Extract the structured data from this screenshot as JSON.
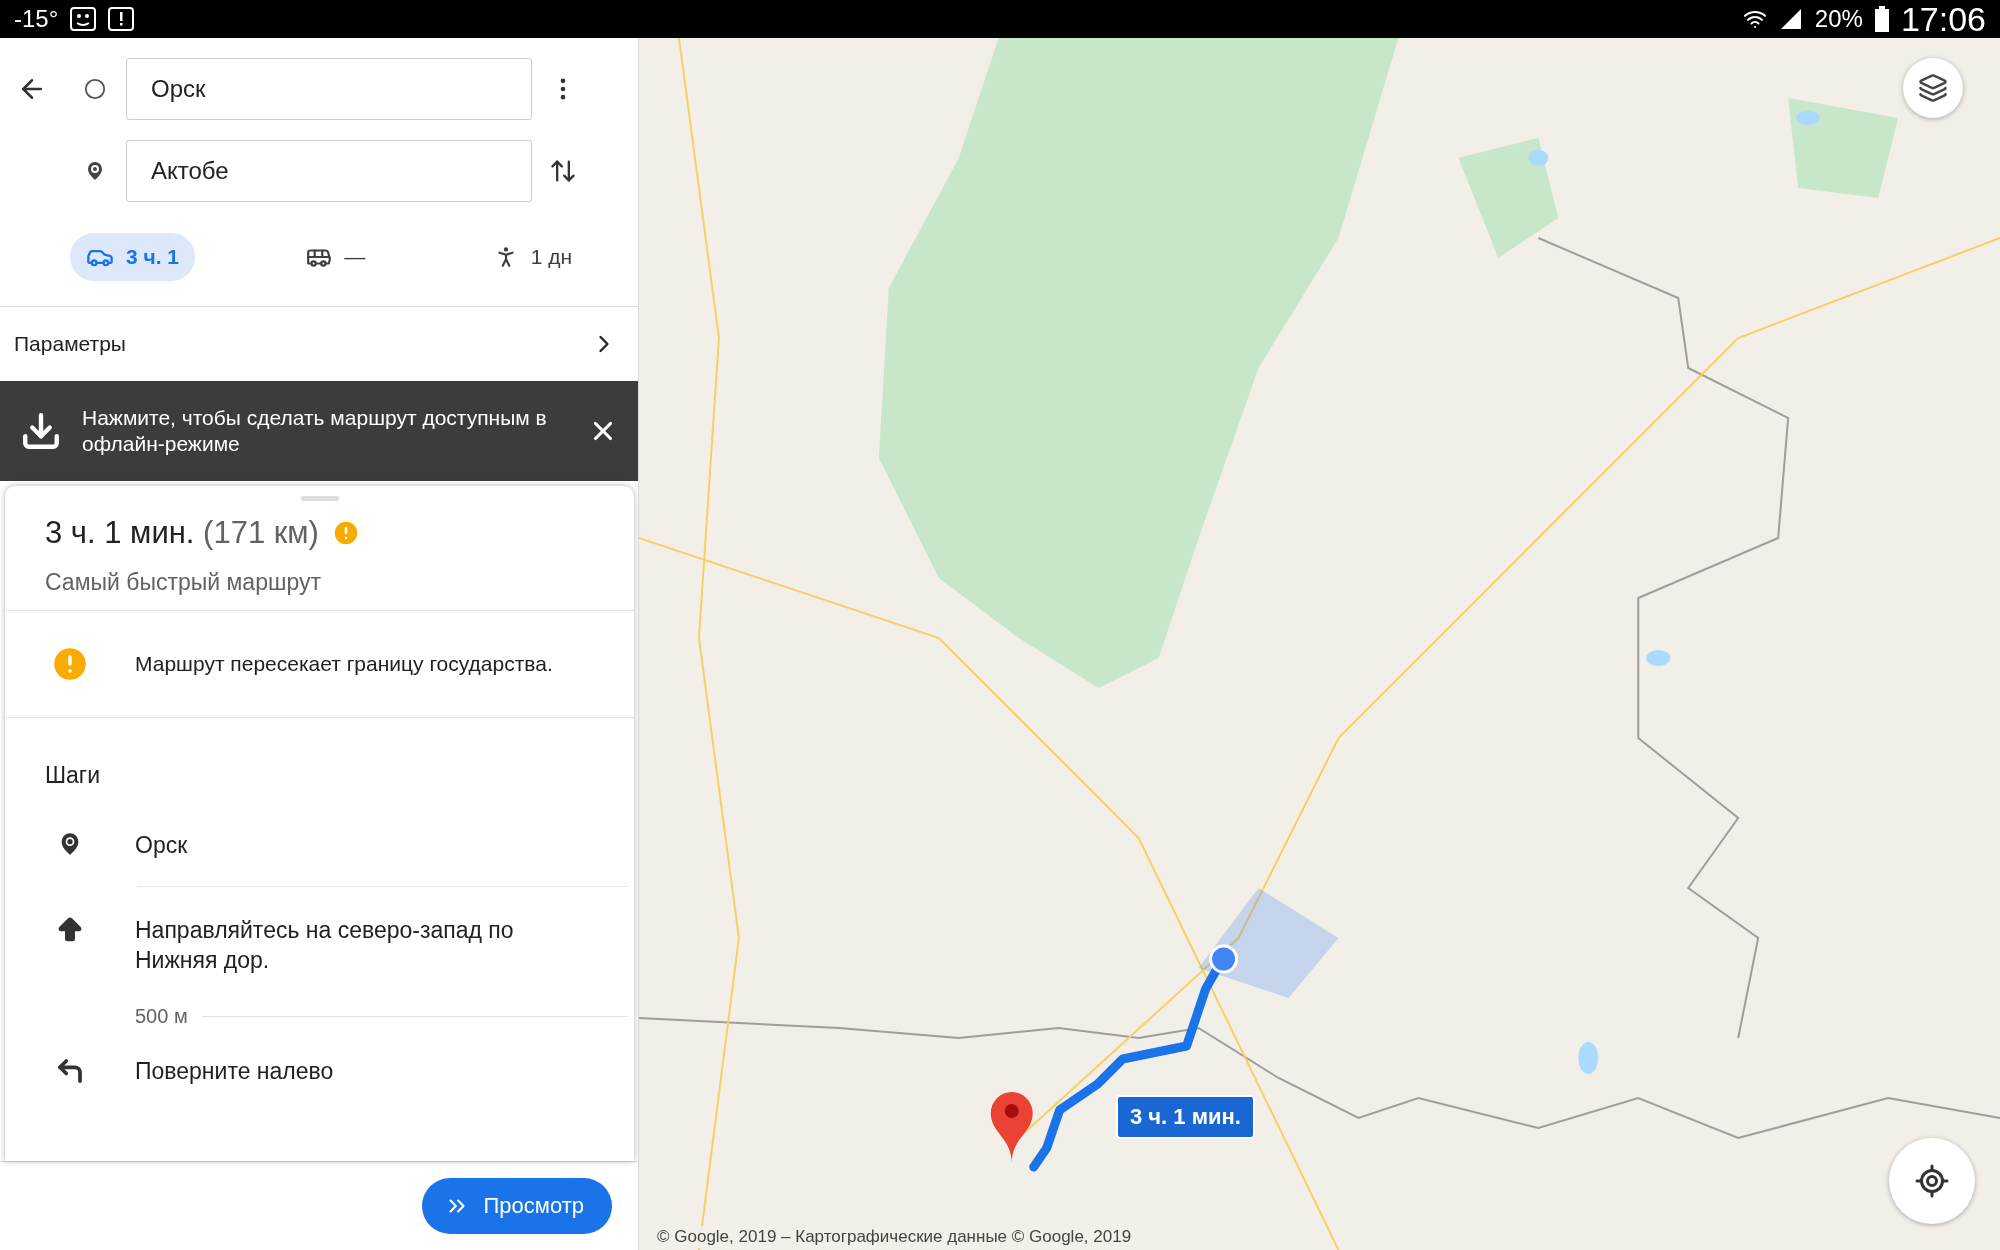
{
  "status_bar": {
    "temperature": "-15°",
    "battery": "20%",
    "time": "17:06"
  },
  "directions": {
    "origin": "Орск",
    "destination": "Актобе",
    "modes": [
      {
        "kind": "car",
        "label": "3 ч. 1",
        "selected": true
      },
      {
        "kind": "transit",
        "label": "—",
        "selected": false
      },
      {
        "kind": "walk",
        "label": "1 дн",
        "selected": false
      }
    ],
    "options_label": "Параметры"
  },
  "offline_banner": {
    "text": "Нажмите, чтобы сделать маршрут доступным в офлайн-режиме"
  },
  "route": {
    "duration": "3 ч. 1 мин.",
    "distance": "(171 км)",
    "subtitle": "Самый быстрый маршрут",
    "warning": "Маршрут пересекает границу государства.",
    "steps_heading": "Шаги",
    "steps": [
      {
        "kind": "place",
        "text": "Орск"
      },
      {
        "kind": "straight",
        "text": "Направляйтесь на северо-запад по Нижняя дор.",
        "distance": "500 м"
      },
      {
        "kind": "left",
        "text": "Поверните налево"
      }
    ],
    "preview_button": "Просмотр"
  },
  "map": {
    "route_label": "3 ч. 1 мин.",
    "copyright": "© Google, 2019 – Картографические данные © Google, 2019"
  }
}
